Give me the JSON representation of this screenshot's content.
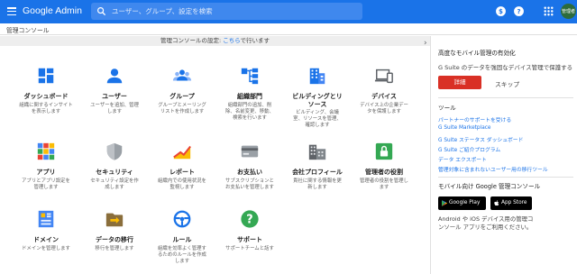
{
  "header": {
    "brand": "Google Admin",
    "search_placeholder": "ユーザー、グループ、設定を検索",
    "avatar_text": "管理者",
    "colors": {
      "bar": "#1a73e8"
    }
  },
  "breadcrumb": "管理コンソール",
  "notice": {
    "prefix": "管理コンソールの設定: ",
    "link": "こちら",
    "suffix": "で行います"
  },
  "tiles": [
    {
      "title": "ダッシュボード",
      "desc": [
        "組織に関するインサイト",
        "を表示します"
      ],
      "icon": "dashboard-icon"
    },
    {
      "title": "ユーザー",
      "desc": [
        "ユーザーを追加、管理",
        "します"
      ],
      "icon": "user-icon"
    },
    {
      "title": "グループ",
      "desc": [
        "グループとメーリング",
        "リストを作成します"
      ],
      "icon": "group-icon"
    },
    {
      "title": "組織部門",
      "desc": [
        "組織部門の追加、削",
        "除、名前変更、移動、",
        "検索を行います"
      ],
      "icon": "org-unit-icon"
    },
    {
      "title": "ビルディングとリ",
      "title2": "ソース",
      "desc": [
        "ビルディング、会議",
        "室、リソースを管理、",
        "確認します"
      ],
      "icon": "building-icon"
    },
    {
      "title": "デバイス",
      "desc": [
        "デバイス上の企業デー",
        "タを保護します"
      ],
      "icon": "devices-icon"
    },
    {
      "title": "アプリ",
      "desc": [
        "アプリとアプリ設定を",
        "管理します"
      ],
      "icon": "apps-icon"
    },
    {
      "title": "セキュリティ",
      "desc": [
        "セキュリティ設定を作",
        "成します"
      ],
      "icon": "security-icon"
    },
    {
      "title": "レポート",
      "desc": [
        "組織内での使用状況を",
        "監視します"
      ],
      "icon": "reports-icon"
    },
    {
      "title": "お支払い",
      "desc": [
        "サブスクリプションと",
        "お支払いを管理します"
      ],
      "icon": "billing-icon"
    },
    {
      "title": "会社プロフィール",
      "desc": [
        "貴社に関する情報を更",
        "新します"
      ],
      "icon": "company-profile-icon"
    },
    {
      "title": "管理者の役割",
      "desc": [
        "管理者の役割を管理し",
        "ます"
      ],
      "icon": "admin-roles-icon"
    },
    {
      "title": "ドメイン",
      "desc": [
        "ドメインを管理します"
      ],
      "icon": "domains-icon"
    },
    {
      "title": "データの移行",
      "desc": [
        "移行を管理します"
      ],
      "icon": "data-migration-icon"
    },
    {
      "title": "ルール",
      "desc": [
        "組織を効率よく管理す",
        "るためのルールを作成",
        "します"
      ],
      "icon": "rules-icon"
    },
    {
      "title": "サポート",
      "desc": [
        "サポートチームと話す"
      ],
      "icon": "support-icon"
    }
  ],
  "right": {
    "mobile_title": "高度なモバイル管理の有効化",
    "mobile_text": "G Suite のデータを強固なデバイス管理で保護する",
    "detail_button": "詳細",
    "skip_button": "スキップ",
    "tools_title": "ツール",
    "tools": [
      "パートナーのサポートを受ける",
      "G Suite Marketplace",
      "G Suite ステータス ダッシュボード",
      "G Suite ご紹介プログラム",
      "データ エクスポート",
      "管理対象に含まれないユーザー用の移行ツール"
    ],
    "mobile_console_title": "モバイル向け Google 管理コンソール",
    "google_play": "Google Play",
    "app_store": "App Store",
    "mobile_console_text": [
      "Android や iOS デバイス用の管理コ",
      "ンソール アプリをご利用ください。"
    ]
  }
}
